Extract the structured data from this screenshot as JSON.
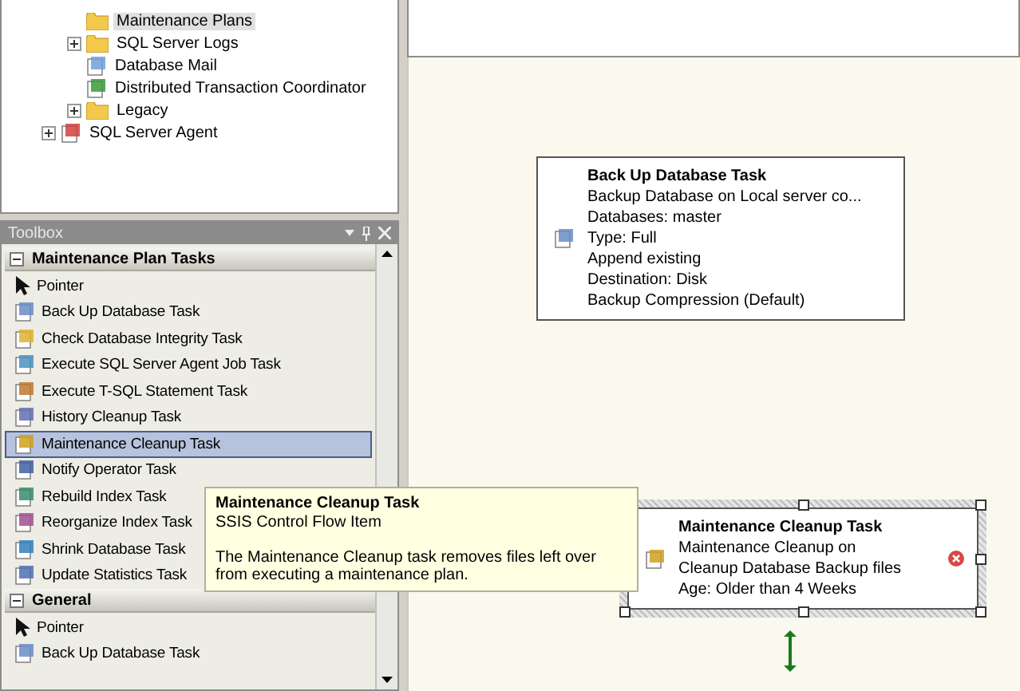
{
  "object_explorer": {
    "nested_items": [
      {
        "label": "Maintenance Plans",
        "kind": "folder",
        "has_children": false,
        "selected": true
      },
      {
        "label": "SQL Server Logs",
        "kind": "folder",
        "has_children": true,
        "selected": false
      },
      {
        "label": "Database Mail",
        "kind": "mail",
        "has_children": false,
        "selected": false
      },
      {
        "label": "Distributed Transaction Coordinator",
        "kind": "dtc",
        "has_children": false,
        "selected": false
      },
      {
        "label": "Legacy",
        "kind": "folder",
        "has_children": true,
        "selected": false
      }
    ],
    "root_items": [
      {
        "label": "SQL Server Agent",
        "kind": "agent",
        "has_children": true,
        "selected": false
      }
    ]
  },
  "toolbox": {
    "title": "Toolbox",
    "sections": [
      {
        "title": "Maintenance Plan Tasks",
        "expanded": true,
        "items": [
          {
            "label": "Pointer",
            "kind": "pointer",
            "selected": false
          },
          {
            "label": "Back Up Database Task",
            "kind": "backup",
            "selected": false
          },
          {
            "label": "Check Database Integrity Task",
            "kind": "check",
            "selected": false
          },
          {
            "label": "Execute SQL Server Agent Job Task",
            "kind": "job",
            "selected": false
          },
          {
            "label": "Execute T-SQL Statement Task",
            "kind": "tsql",
            "selected": false
          },
          {
            "label": "History Cleanup Task",
            "kind": "history",
            "selected": false
          },
          {
            "label": "Maintenance Cleanup Task",
            "kind": "cleanup",
            "selected": true
          },
          {
            "label": "Notify Operator Task",
            "kind": "notify",
            "selected": false
          },
          {
            "label": "Rebuild Index Task",
            "kind": "index",
            "selected": false
          },
          {
            "label": "Reorganize Index Task",
            "kind": "reorg",
            "selected": false
          },
          {
            "label": "Shrink Database Task",
            "kind": "shrink",
            "selected": false
          },
          {
            "label": "Update Statistics Task",
            "kind": "stats",
            "selected": false
          }
        ]
      },
      {
        "title": "General",
        "expanded": true,
        "items": [
          {
            "label": "Pointer",
            "kind": "pointer",
            "selected": false
          },
          {
            "label": "Back Up Database Task",
            "kind": "backup",
            "selected": false
          }
        ]
      }
    ]
  },
  "tooltip": {
    "title": "Maintenance Cleanup Task",
    "subtitle": "SSIS Control Flow Item",
    "description": "The Maintenance Cleanup task removes files left over from executing a maintenance plan."
  },
  "designer": {
    "tasks": [
      {
        "title": "Back Up Database Task",
        "kind": "backup",
        "selected": false,
        "error": false,
        "lines": [
          "Backup Database on Local server co...",
          "Databases: master",
          "Type: Full",
          "Append existing",
          "Destination: Disk",
          "Backup Compression (Default)"
        ]
      },
      {
        "title": "Maintenance Cleanup Task",
        "kind": "cleanup",
        "selected": true,
        "error": true,
        "lines": [
          "Maintenance Cleanup on",
          "Cleanup Database Backup files",
          "Age: Older than 4 Weeks"
        ]
      }
    ]
  }
}
